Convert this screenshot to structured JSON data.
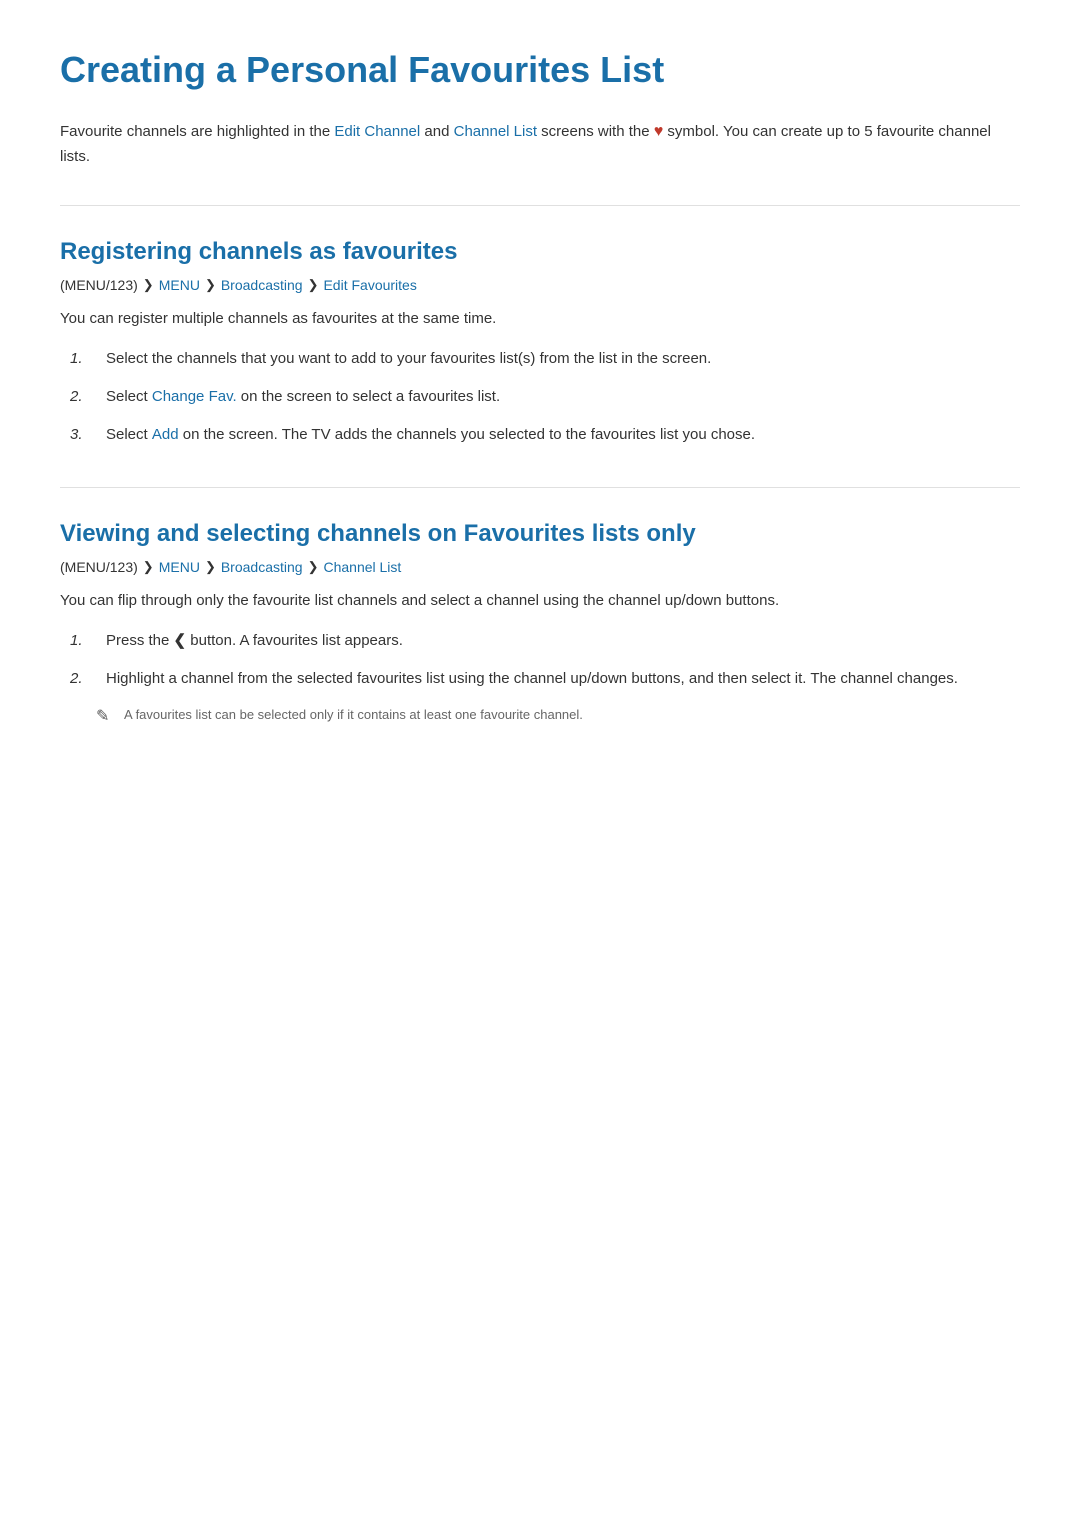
{
  "page": {
    "title": "Creating a Personal Favourites List",
    "intro": {
      "text_before": "Favourite channels are highlighted in the ",
      "link1": "Edit Channel",
      "text_middle": " and ",
      "link2": "Channel List",
      "text_after": " screens with the",
      "symbol_desc": "heart",
      "text_end": " symbol. You can create up to 5 favourite channel lists."
    }
  },
  "section1": {
    "heading": "Registering channels as favourites",
    "breadcrumb": {
      "prefix": "(MENU/123)",
      "items": [
        "MENU",
        "Broadcasting",
        "Edit Favourites"
      ]
    },
    "intro_text": "You can register multiple channels as favourites at the same time.",
    "steps": [
      {
        "num": "1.",
        "text_before": "Select the channels that you want to add to your favourites list(s) from the list in the screen."
      },
      {
        "num": "2.",
        "text_before": "Select ",
        "link": "Change Fav.",
        "text_after": " on the screen to select a favourites list."
      },
      {
        "num": "3.",
        "text_before": "Select ",
        "link": "Add",
        "text_after": " on the screen. The TV adds the channels you selected to the favourites list you chose."
      }
    ]
  },
  "section2": {
    "heading": "Viewing and selecting channels on Favourites lists only",
    "breadcrumb": {
      "prefix": "(MENU/123)",
      "items": [
        "MENU",
        "Broadcasting",
        "Channel List"
      ]
    },
    "intro_text": "You can flip through only the favourite list channels and select a channel using the channel up/down buttons.",
    "steps": [
      {
        "num": "1.",
        "text_before": "Press the ",
        "symbol": "❮",
        "text_after": " button. A favourites list appears."
      },
      {
        "num": "2.",
        "text": "Highlight a channel from the selected favourites list using the channel up/down buttons, and then select it. The channel changes."
      }
    ],
    "note": "A favourites list can be selected only if it contains at least one favourite channel."
  },
  "colors": {
    "primary_blue": "#1a6fa8",
    "text_dark": "#333333",
    "text_muted": "#666666",
    "heart_red": "#c0392b",
    "background": "#ffffff"
  }
}
